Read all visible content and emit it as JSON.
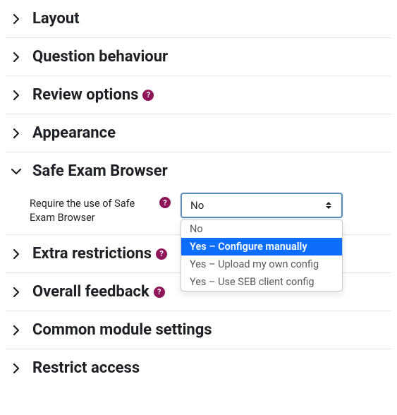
{
  "sections": {
    "layout": {
      "title": "Layout"
    },
    "question_behaviour": {
      "title": "Question behaviour"
    },
    "review_options": {
      "title": "Review options",
      "has_help": true
    },
    "appearance": {
      "title": "Appearance"
    },
    "seb": {
      "title": "Safe Exam Browser"
    },
    "extra_restrictions": {
      "title": "Extra restrictions",
      "has_help": true
    },
    "overall_feedback": {
      "title": "Overall feedback",
      "has_help": true
    },
    "common_module": {
      "title": "Common module settings"
    },
    "restrict_access": {
      "title": "Restrict access"
    }
  },
  "seb_field": {
    "label": "Require the use of Safe Exam Browser",
    "selected_value": "No",
    "options": [
      "No",
      "Yes – Configure manually",
      "Yes – Upload my own config",
      "Yes – Use SEB client config"
    ],
    "highlighted_index": 1
  },
  "help_glyph": "?"
}
